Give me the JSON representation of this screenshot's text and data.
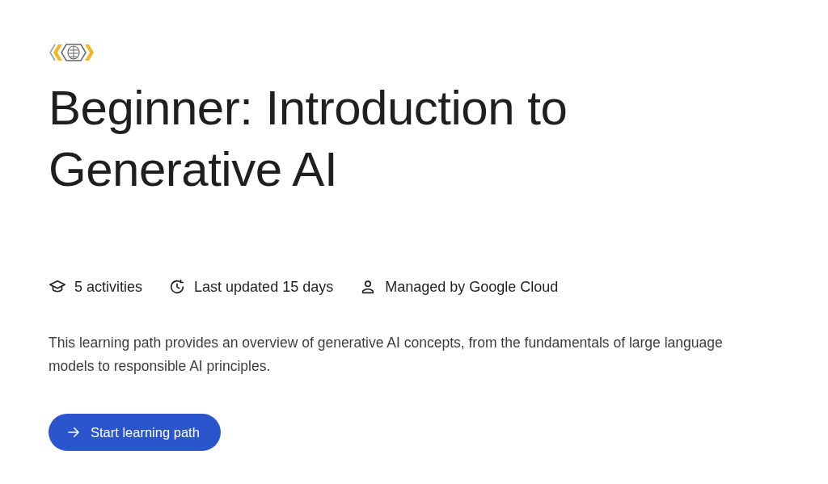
{
  "title": "Beginner: Introduction to Generative AI",
  "meta": [
    {
      "kind": "activities",
      "text": "5 activities"
    },
    {
      "kind": "updated",
      "text": "Last updated 15 days"
    },
    {
      "kind": "managed",
      "text": "Managed by Google Cloud"
    }
  ],
  "description": "This learning path provides an overview of generative AI concepts, from the fundamentals of large language models to responsible AI principles.",
  "button": {
    "label": "Start learning path"
  }
}
